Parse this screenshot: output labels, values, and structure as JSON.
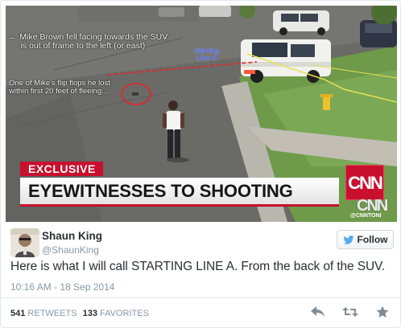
{
  "media": {
    "annotation_direction": "← Mike Brown fell facing towards the SUV\n     is out of frame to the left (or east)",
    "annotation_flipflop": "One of Mike's flip flops he lost\nwithin first 20 feet of fleeing....",
    "annotation_line": "Starting\nLine A",
    "banner_label": "EXCLUSIVE",
    "banner_headline": "EYEWITNESSES TO SHOOTING",
    "network_logo": "CNN",
    "network_logo_white": "CNN",
    "network_handle": "@CNNTONI"
  },
  "author": {
    "name": "Shaun King",
    "handle": "@ShaunKing"
  },
  "follow_label": "Follow",
  "tweet": {
    "text": "Here is what I will call STARTING LINE A. From the back of the SUV.",
    "timestamp": "10:16 AM - 18 Sep 2014"
  },
  "stats": {
    "retweets_count": "541",
    "retweets_label": "RETWEETS",
    "favorites_count": "133",
    "favorites_label": "FAVORITES"
  },
  "colors": {
    "cnn_red": "#c8102e",
    "follow_bird": "#55acee",
    "muted_text": "#8899a6"
  },
  "icons": [
    "reply-icon",
    "retweet-icon",
    "favorite-icon",
    "twitter-bird-icon"
  ]
}
